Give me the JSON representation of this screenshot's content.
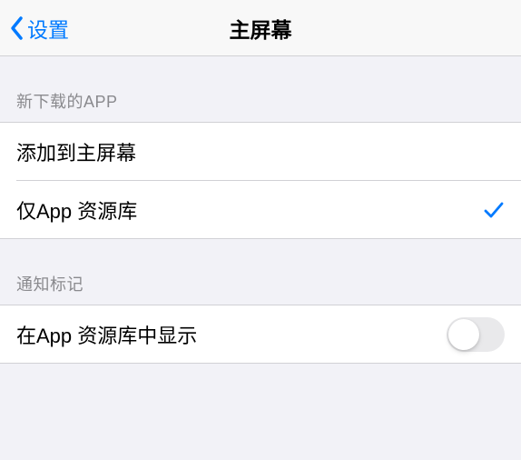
{
  "nav": {
    "back_label": "设置",
    "title": "主屏幕"
  },
  "sections": {
    "new_apps": {
      "header": "新下载的APP",
      "options": {
        "add_to_home": "添加到主屏幕",
        "app_library_only": "仅App 资源库"
      },
      "selected": "app_library_only"
    },
    "badges": {
      "header": "通知标记",
      "show_in_library": "在App 资源库中显示",
      "toggle_on": false
    }
  }
}
